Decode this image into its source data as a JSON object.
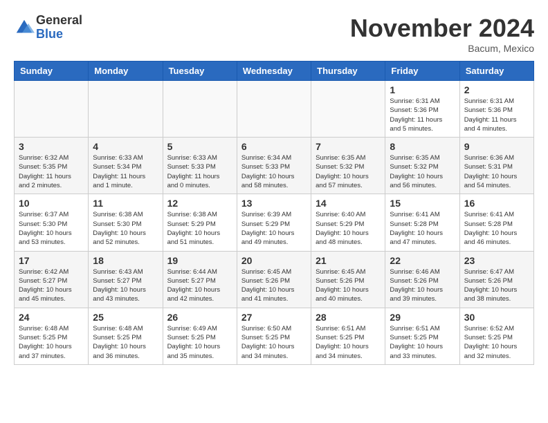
{
  "header": {
    "logo_general": "General",
    "logo_blue": "Blue",
    "month_title": "November 2024",
    "location": "Bacum, Mexico"
  },
  "weekdays": [
    "Sunday",
    "Monday",
    "Tuesday",
    "Wednesday",
    "Thursday",
    "Friday",
    "Saturday"
  ],
  "weeks": [
    [
      {
        "day": "",
        "info": ""
      },
      {
        "day": "",
        "info": ""
      },
      {
        "day": "",
        "info": ""
      },
      {
        "day": "",
        "info": ""
      },
      {
        "day": "",
        "info": ""
      },
      {
        "day": "1",
        "info": "Sunrise: 6:31 AM\nSunset: 5:36 PM\nDaylight: 11 hours\nand 5 minutes."
      },
      {
        "day": "2",
        "info": "Sunrise: 6:31 AM\nSunset: 5:36 PM\nDaylight: 11 hours\nand 4 minutes."
      }
    ],
    [
      {
        "day": "3",
        "info": "Sunrise: 6:32 AM\nSunset: 5:35 PM\nDaylight: 11 hours\nand 2 minutes."
      },
      {
        "day": "4",
        "info": "Sunrise: 6:33 AM\nSunset: 5:34 PM\nDaylight: 11 hours\nand 1 minute."
      },
      {
        "day": "5",
        "info": "Sunrise: 6:33 AM\nSunset: 5:33 PM\nDaylight: 11 hours\nand 0 minutes."
      },
      {
        "day": "6",
        "info": "Sunrise: 6:34 AM\nSunset: 5:33 PM\nDaylight: 10 hours\nand 58 minutes."
      },
      {
        "day": "7",
        "info": "Sunrise: 6:35 AM\nSunset: 5:32 PM\nDaylight: 10 hours\nand 57 minutes."
      },
      {
        "day": "8",
        "info": "Sunrise: 6:35 AM\nSunset: 5:32 PM\nDaylight: 10 hours\nand 56 minutes."
      },
      {
        "day": "9",
        "info": "Sunrise: 6:36 AM\nSunset: 5:31 PM\nDaylight: 10 hours\nand 54 minutes."
      }
    ],
    [
      {
        "day": "10",
        "info": "Sunrise: 6:37 AM\nSunset: 5:30 PM\nDaylight: 10 hours\nand 53 minutes."
      },
      {
        "day": "11",
        "info": "Sunrise: 6:38 AM\nSunset: 5:30 PM\nDaylight: 10 hours\nand 52 minutes."
      },
      {
        "day": "12",
        "info": "Sunrise: 6:38 AM\nSunset: 5:29 PM\nDaylight: 10 hours\nand 51 minutes."
      },
      {
        "day": "13",
        "info": "Sunrise: 6:39 AM\nSunset: 5:29 PM\nDaylight: 10 hours\nand 49 minutes."
      },
      {
        "day": "14",
        "info": "Sunrise: 6:40 AM\nSunset: 5:29 PM\nDaylight: 10 hours\nand 48 minutes."
      },
      {
        "day": "15",
        "info": "Sunrise: 6:41 AM\nSunset: 5:28 PM\nDaylight: 10 hours\nand 47 minutes."
      },
      {
        "day": "16",
        "info": "Sunrise: 6:41 AM\nSunset: 5:28 PM\nDaylight: 10 hours\nand 46 minutes."
      }
    ],
    [
      {
        "day": "17",
        "info": "Sunrise: 6:42 AM\nSunset: 5:27 PM\nDaylight: 10 hours\nand 45 minutes."
      },
      {
        "day": "18",
        "info": "Sunrise: 6:43 AM\nSunset: 5:27 PM\nDaylight: 10 hours\nand 43 minutes."
      },
      {
        "day": "19",
        "info": "Sunrise: 6:44 AM\nSunset: 5:27 PM\nDaylight: 10 hours\nand 42 minutes."
      },
      {
        "day": "20",
        "info": "Sunrise: 6:45 AM\nSunset: 5:26 PM\nDaylight: 10 hours\nand 41 minutes."
      },
      {
        "day": "21",
        "info": "Sunrise: 6:45 AM\nSunset: 5:26 PM\nDaylight: 10 hours\nand 40 minutes."
      },
      {
        "day": "22",
        "info": "Sunrise: 6:46 AM\nSunset: 5:26 PM\nDaylight: 10 hours\nand 39 minutes."
      },
      {
        "day": "23",
        "info": "Sunrise: 6:47 AM\nSunset: 5:26 PM\nDaylight: 10 hours\nand 38 minutes."
      }
    ],
    [
      {
        "day": "24",
        "info": "Sunrise: 6:48 AM\nSunset: 5:25 PM\nDaylight: 10 hours\nand 37 minutes."
      },
      {
        "day": "25",
        "info": "Sunrise: 6:48 AM\nSunset: 5:25 PM\nDaylight: 10 hours\nand 36 minutes."
      },
      {
        "day": "26",
        "info": "Sunrise: 6:49 AM\nSunset: 5:25 PM\nDaylight: 10 hours\nand 35 minutes."
      },
      {
        "day": "27",
        "info": "Sunrise: 6:50 AM\nSunset: 5:25 PM\nDaylight: 10 hours\nand 34 minutes."
      },
      {
        "day": "28",
        "info": "Sunrise: 6:51 AM\nSunset: 5:25 PM\nDaylight: 10 hours\nand 34 minutes."
      },
      {
        "day": "29",
        "info": "Sunrise: 6:51 AM\nSunset: 5:25 PM\nDaylight: 10 hours\nand 33 minutes."
      },
      {
        "day": "30",
        "info": "Sunrise: 6:52 AM\nSunset: 5:25 PM\nDaylight: 10 hours\nand 32 minutes."
      }
    ]
  ]
}
